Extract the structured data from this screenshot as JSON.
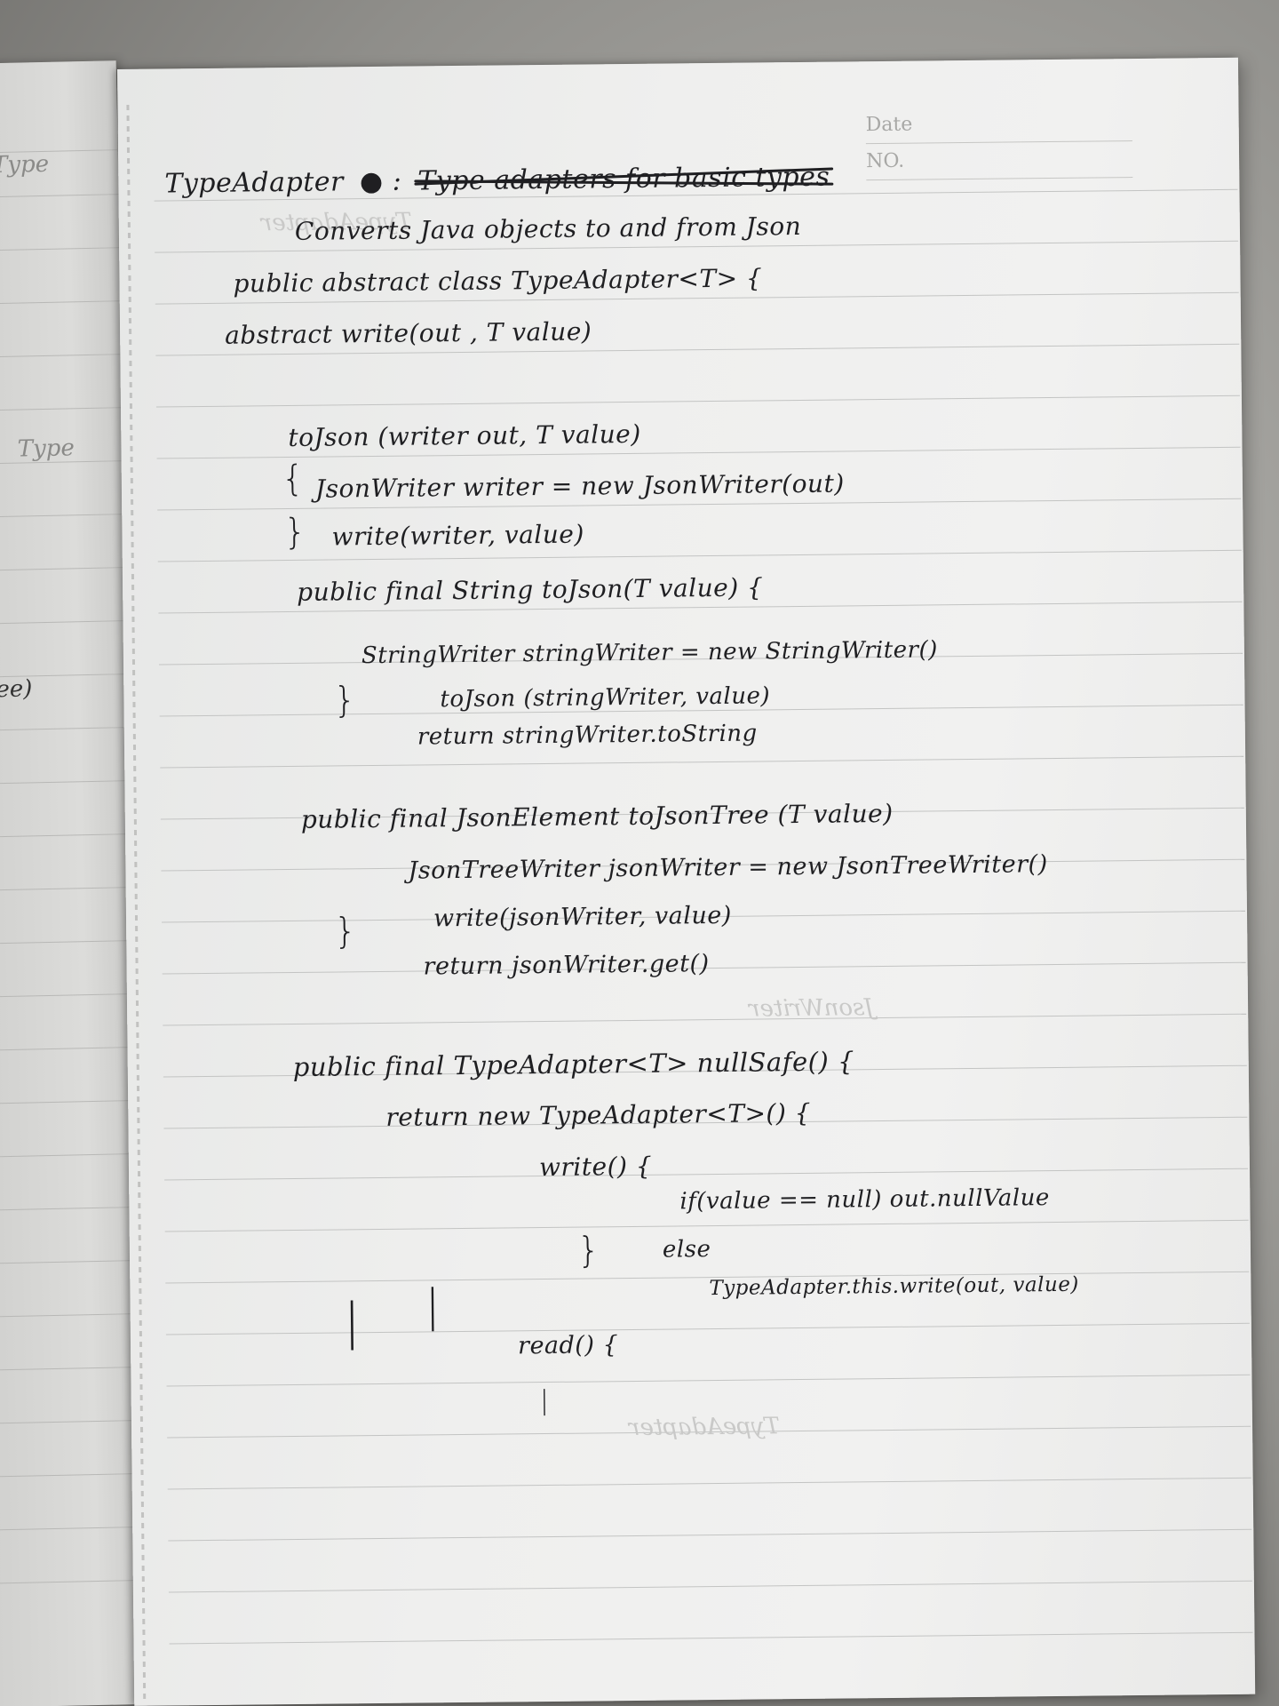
{
  "page": {
    "header": {
      "date_label": "Date",
      "no_label": "NO."
    },
    "title": {
      "name": "TypeAdapter",
      "struck_text": "Type adapters for basic types"
    },
    "lines": [
      "Converts Java objects to and from Json",
      "public abstract class TypeAdapter<T> {",
      "abstract write(out , T value)",
      "toJson (writer out, T value)",
      "JsonWriter writer = new JsonWriter(out)",
      "write(writer, value)",
      "public final String toJson(T value) {",
      "StringWriter stringWriter = new StringWriter()",
      "toJson (stringWriter, value)",
      "return stringWriter.toString",
      "public final JsonElement toJsonTree (T value)",
      "JsonTreeWriter jsonWriter = new JsonTreeWriter()",
      "write(jsonWriter, value)",
      "return jsonWriter.get()",
      "public final TypeAdapter<T> nullSafe() {",
      "return new TypeAdapter<T>() {",
      "write() {",
      "if(value == null) out.nullValue",
      "else",
      "TypeAdapter.this.write(out, value)",
      "read() {"
    ],
    "left_page_fragments": [
      "Type",
      "ee)",
      "Type"
    ]
  }
}
